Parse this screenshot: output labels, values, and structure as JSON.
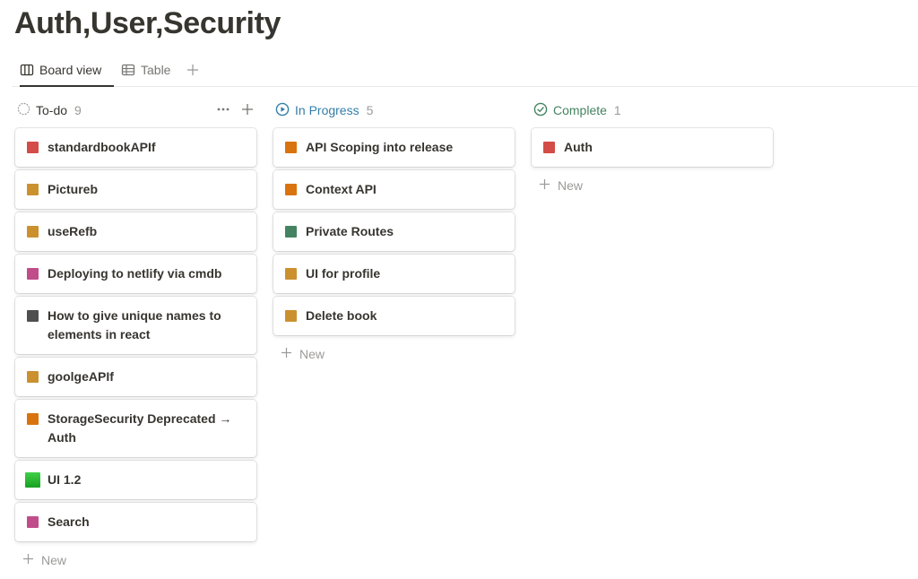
{
  "page": {
    "title": "Auth,User,Security"
  },
  "tabs": [
    {
      "label": "Board view",
      "icon": "board-icon",
      "active": true
    },
    {
      "label": "Table",
      "icon": "table-icon",
      "active": false
    }
  ],
  "board": {
    "new_label": "New",
    "columns": [
      {
        "title": "To-do",
        "count": "9",
        "color": "#37352f",
        "icon": "circle-dashed-icon",
        "cards": [
          {
            "title": "standardbookAPIf",
            "color": "#d44c47"
          },
          {
            "title": "Pictureb",
            "color": "#cb912f"
          },
          {
            "title": "useRefb",
            "color": "#cb912f"
          },
          {
            "title": "Deploying to netlify via cmdb",
            "color": "#c14c8a"
          },
          {
            "title": "How to give unique names to elements in react",
            "color": "#4f4f4f"
          },
          {
            "title": "goolgeAPIf",
            "color": "#cb912f"
          },
          {
            "title": "StorageSecurity Deprecated → Auth",
            "color": "#d9730d"
          },
          {
            "title": "UI 1.2",
            "color": "#22b52b"
          },
          {
            "title": "Search",
            "color": "#c14c8a"
          }
        ]
      },
      {
        "title": "In Progress",
        "count": "5",
        "color": "#337ea9",
        "icon": "play-circle-icon",
        "cards": [
          {
            "title": "API Scoping into release",
            "color": "#d9730d"
          },
          {
            "title": "Context API",
            "color": "#d9730d"
          },
          {
            "title": "Private Routes",
            "color": "#448361"
          },
          {
            "title": "UI for profile",
            "color": "#cb912f"
          },
          {
            "title": "Delete book",
            "color": "#cb912f"
          }
        ]
      },
      {
        "title": "Complete",
        "count": "1",
        "color": "#448361",
        "icon": "check-circle-icon",
        "cards": [
          {
            "title": "Auth",
            "color": "#d44c47"
          }
        ]
      }
    ]
  }
}
